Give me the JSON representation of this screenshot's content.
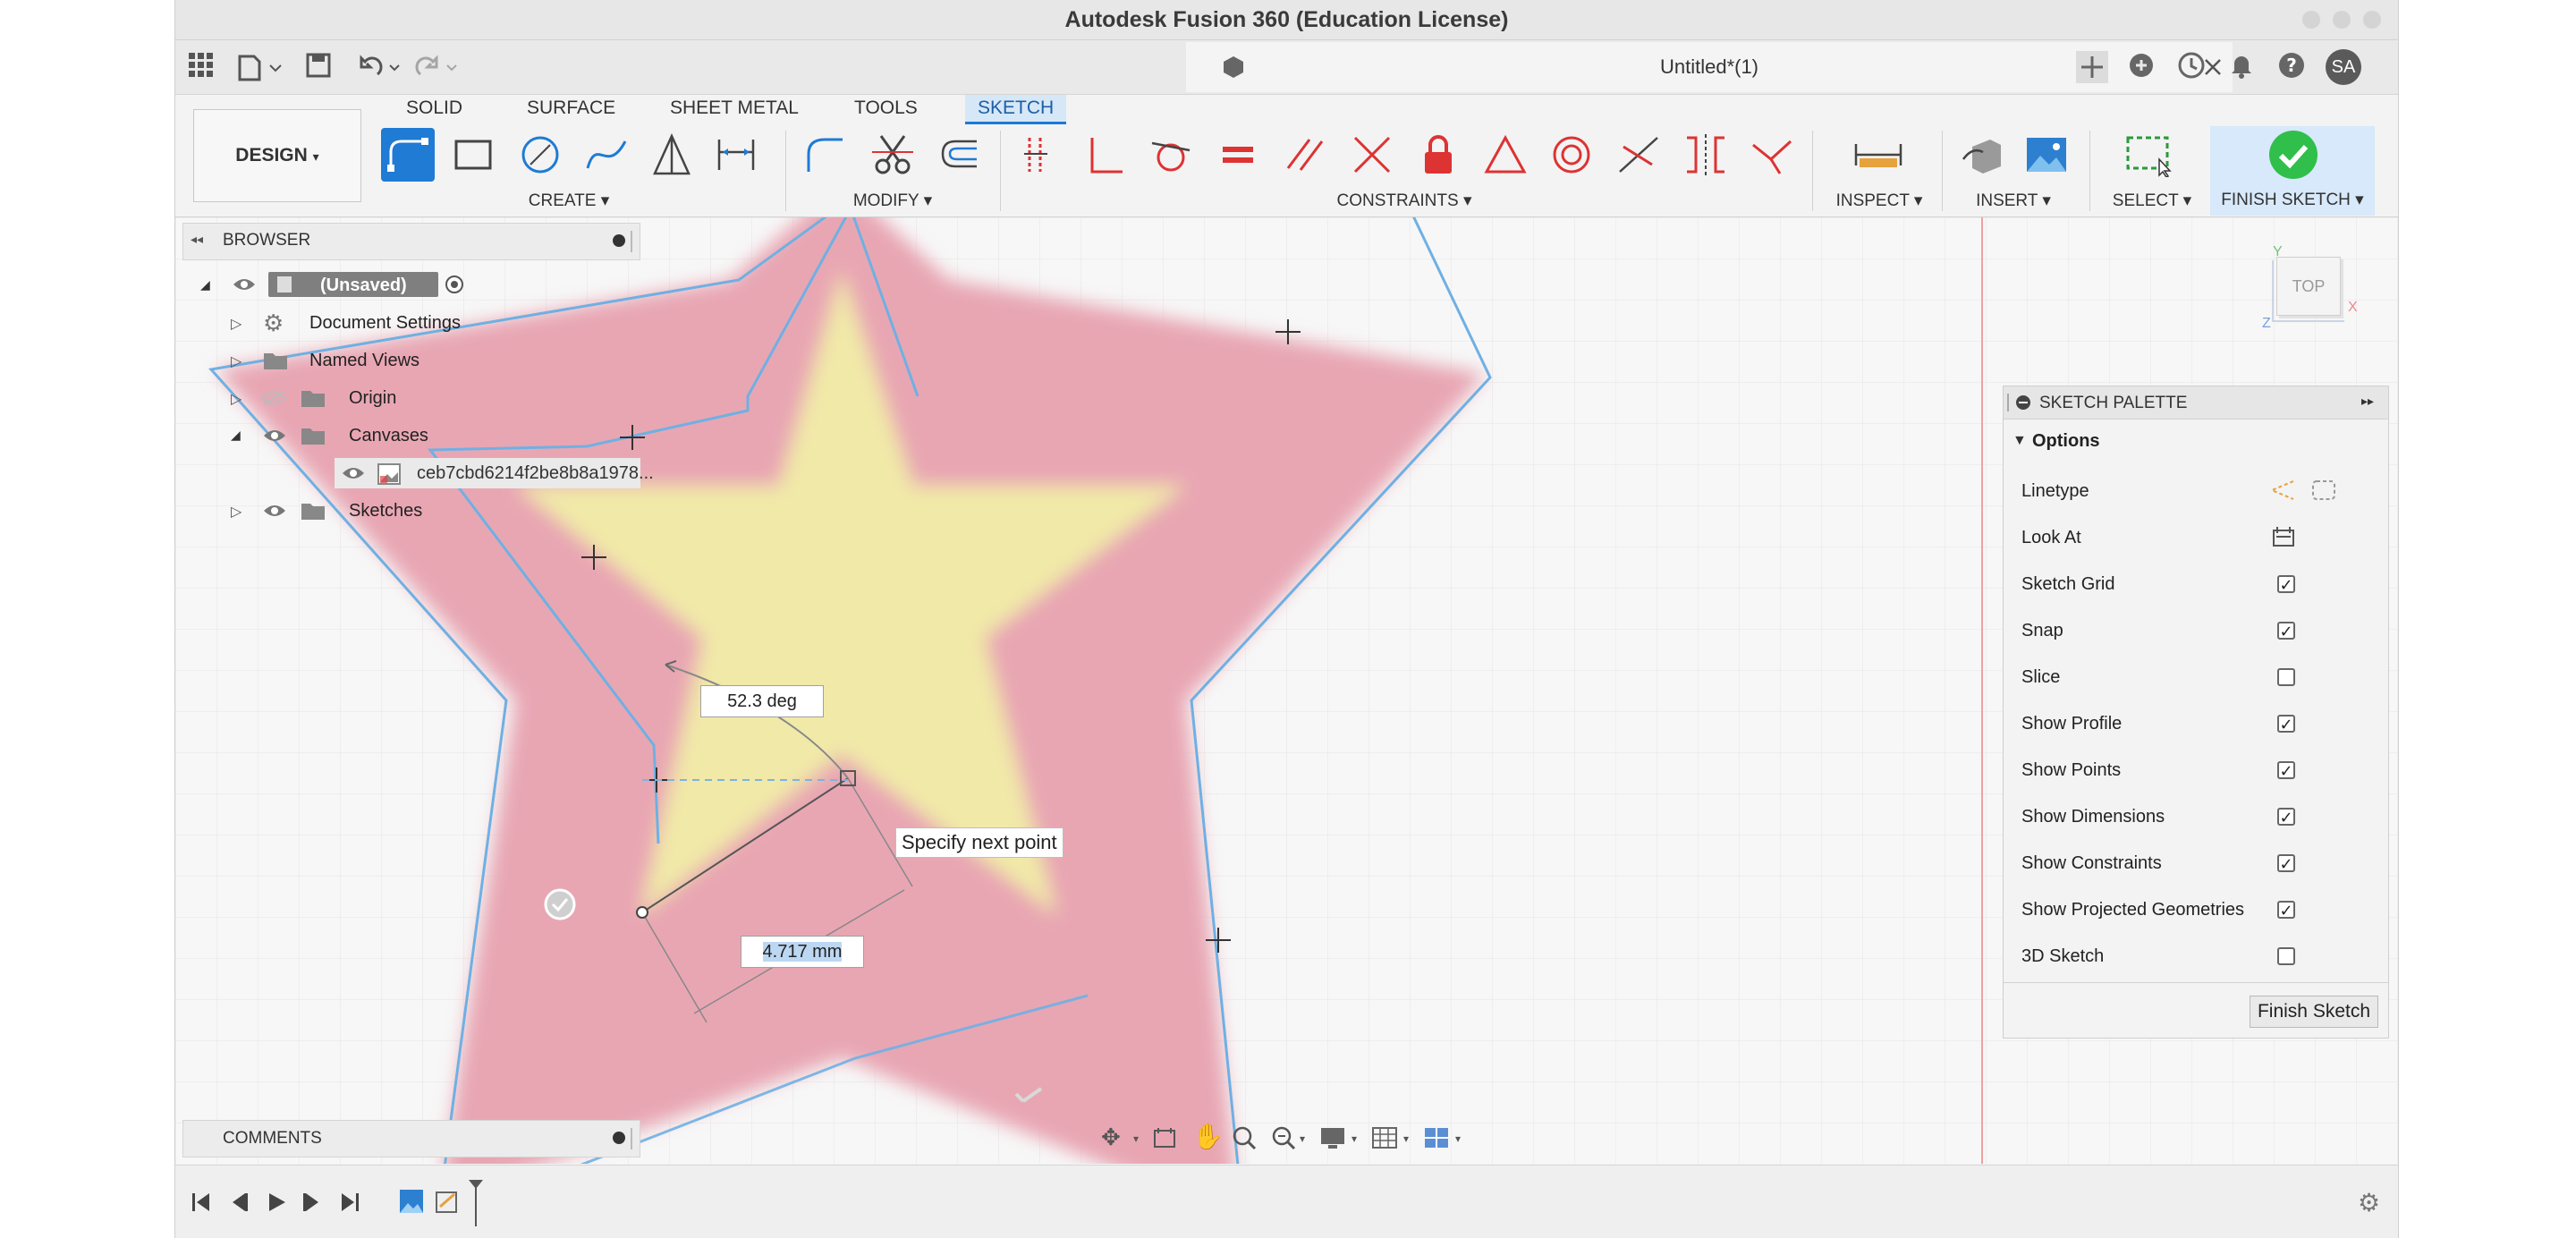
{
  "window": {
    "title": "Autodesk Fusion 360 (Education License)",
    "doc_tab_title": "Untitled*(1)",
    "user_initials": "SA"
  },
  "ribbon": {
    "workspace": "DESIGN",
    "tabs": [
      "SOLID",
      "SURFACE",
      "SHEET METAL",
      "TOOLS",
      "SKETCH"
    ],
    "active_tab": "SKETCH",
    "groups": {
      "create": "CREATE",
      "modify": "MODIFY",
      "constraints": "CONSTRAINTS",
      "inspect": "INSPECT",
      "insert": "INSERT",
      "select": "SELECT",
      "finish": "FINISH SKETCH"
    },
    "accent": "#1f7bd4",
    "finish_green": "#2fbf4a"
  },
  "browser": {
    "title": "BROWSER",
    "root": "(Unsaved)",
    "items": [
      {
        "label": "Document Settings"
      },
      {
        "label": "Named Views"
      },
      {
        "label": "Origin"
      },
      {
        "label": "Canvases"
      },
      {
        "label": "ceb7cbd6214f2be8b8a1978..."
      },
      {
        "label": "Sketches"
      }
    ]
  },
  "comments": {
    "title": "COMMENTS"
  },
  "view_cube": {
    "face": "TOP",
    "x_axis": "X",
    "y_axis": "Y",
    "z_axis": "Z"
  },
  "sketch_palette": {
    "title": "SKETCH PALETTE",
    "section": "Options",
    "options": [
      {
        "label": "Linetype",
        "type": "icons"
      },
      {
        "label": "Look At",
        "type": "icon"
      },
      {
        "label": "Sketch Grid",
        "type": "checkbox",
        "checked": true
      },
      {
        "label": "Snap",
        "type": "checkbox",
        "checked": true
      },
      {
        "label": "Slice",
        "type": "checkbox",
        "checked": false
      },
      {
        "label": "Show Profile",
        "type": "checkbox",
        "checked": true
      },
      {
        "label": "Show Points",
        "type": "checkbox",
        "checked": true
      },
      {
        "label": "Show Dimensions",
        "type": "checkbox",
        "checked": true
      },
      {
        "label": "Show Constraints",
        "type": "checkbox",
        "checked": true
      },
      {
        "label": "Show Projected Geometries",
        "type": "checkbox",
        "checked": true
      },
      {
        "label": "3D Sketch",
        "type": "checkbox",
        "checked": false
      }
    ],
    "finish_button": "Finish Sketch"
  },
  "sketch": {
    "angle_dim": "52.3 deg",
    "length_dim": "4.717 mm",
    "tooltip": "Specify next point",
    "line_color": "#6fb0e3",
    "star_fill": "#e8a6b3",
    "inner_fill": "#f1e9a8"
  }
}
